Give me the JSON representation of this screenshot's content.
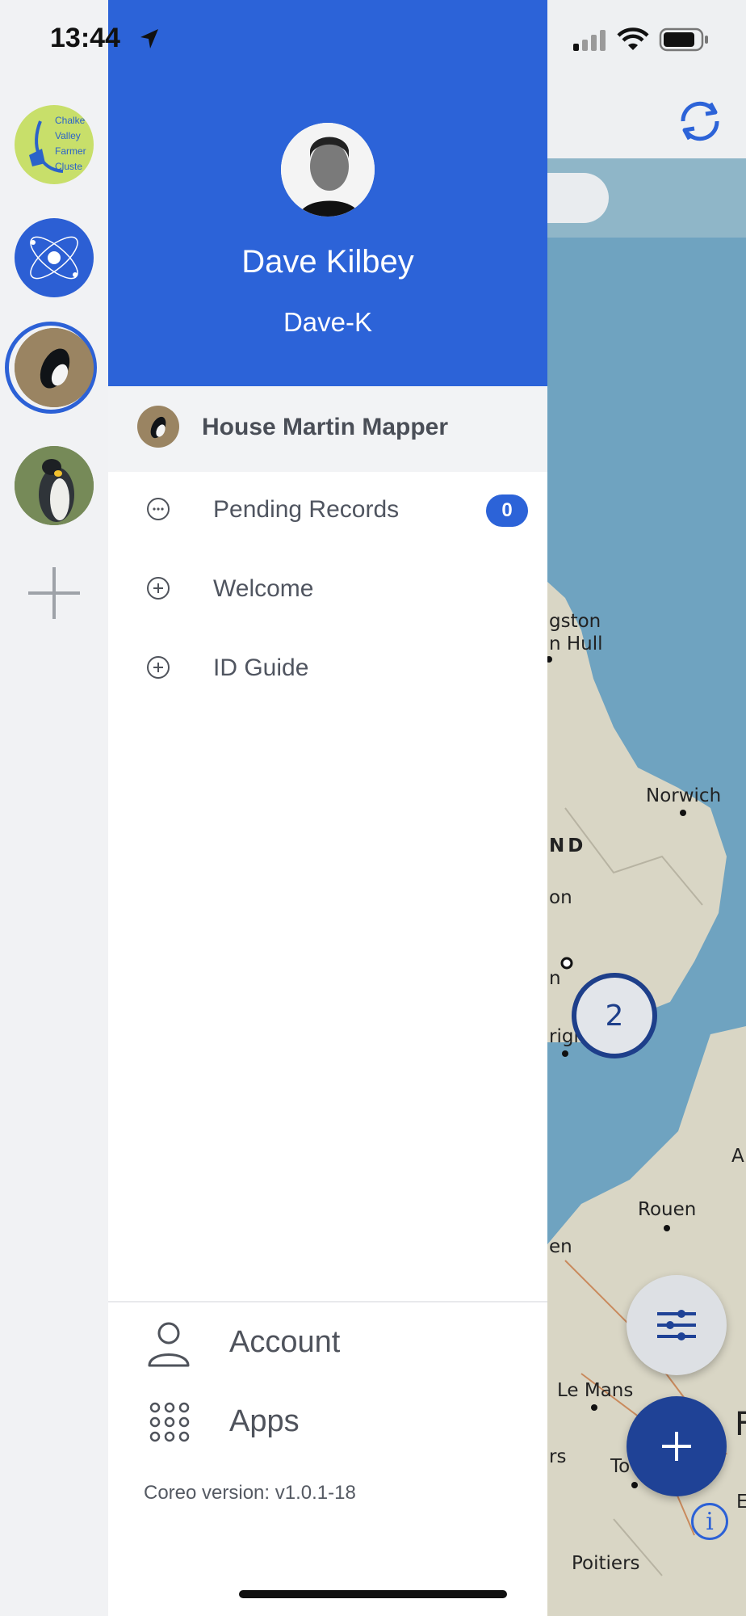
{
  "status_bar": {
    "time": "13:44"
  },
  "profile": {
    "name": "Dave Kilbey",
    "handle": "Dave-K"
  },
  "project": {
    "title": "House Martin Mapper"
  },
  "menu": {
    "pending": {
      "label": "Pending Records",
      "count": "0"
    },
    "welcome": {
      "label": "Welcome"
    },
    "id_guide": {
      "label": "ID Guide"
    }
  },
  "bottom_menu": {
    "account": "Account",
    "apps": "Apps"
  },
  "version": "Coreo version: v1.0.1-18",
  "rail": {
    "apps": [
      {
        "name": "Chalke Valley Farmer Cluster",
        "lines": [
          "Chalke",
          "Valley",
          "Farmer",
          "Cluste"
        ]
      },
      {
        "name": "atom-app"
      },
      {
        "name": "House Martin Mapper"
      },
      {
        "name": "penguin-app"
      }
    ]
  },
  "map": {
    "cluster_count": "2",
    "labels": [
      "gston",
      "n Hull",
      "Norwich",
      "ND",
      "on",
      "n",
      "righ",
      "A",
      "Rouen",
      "en",
      "Le Mans",
      "rs",
      "To",
      "Poitiers",
      "F",
      "E"
    ]
  },
  "colors": {
    "brand_blue": "#2c63d8",
    "fab_blue": "#1f4296",
    "sea": "#6fa3c0",
    "land": "#d9d6c5"
  }
}
